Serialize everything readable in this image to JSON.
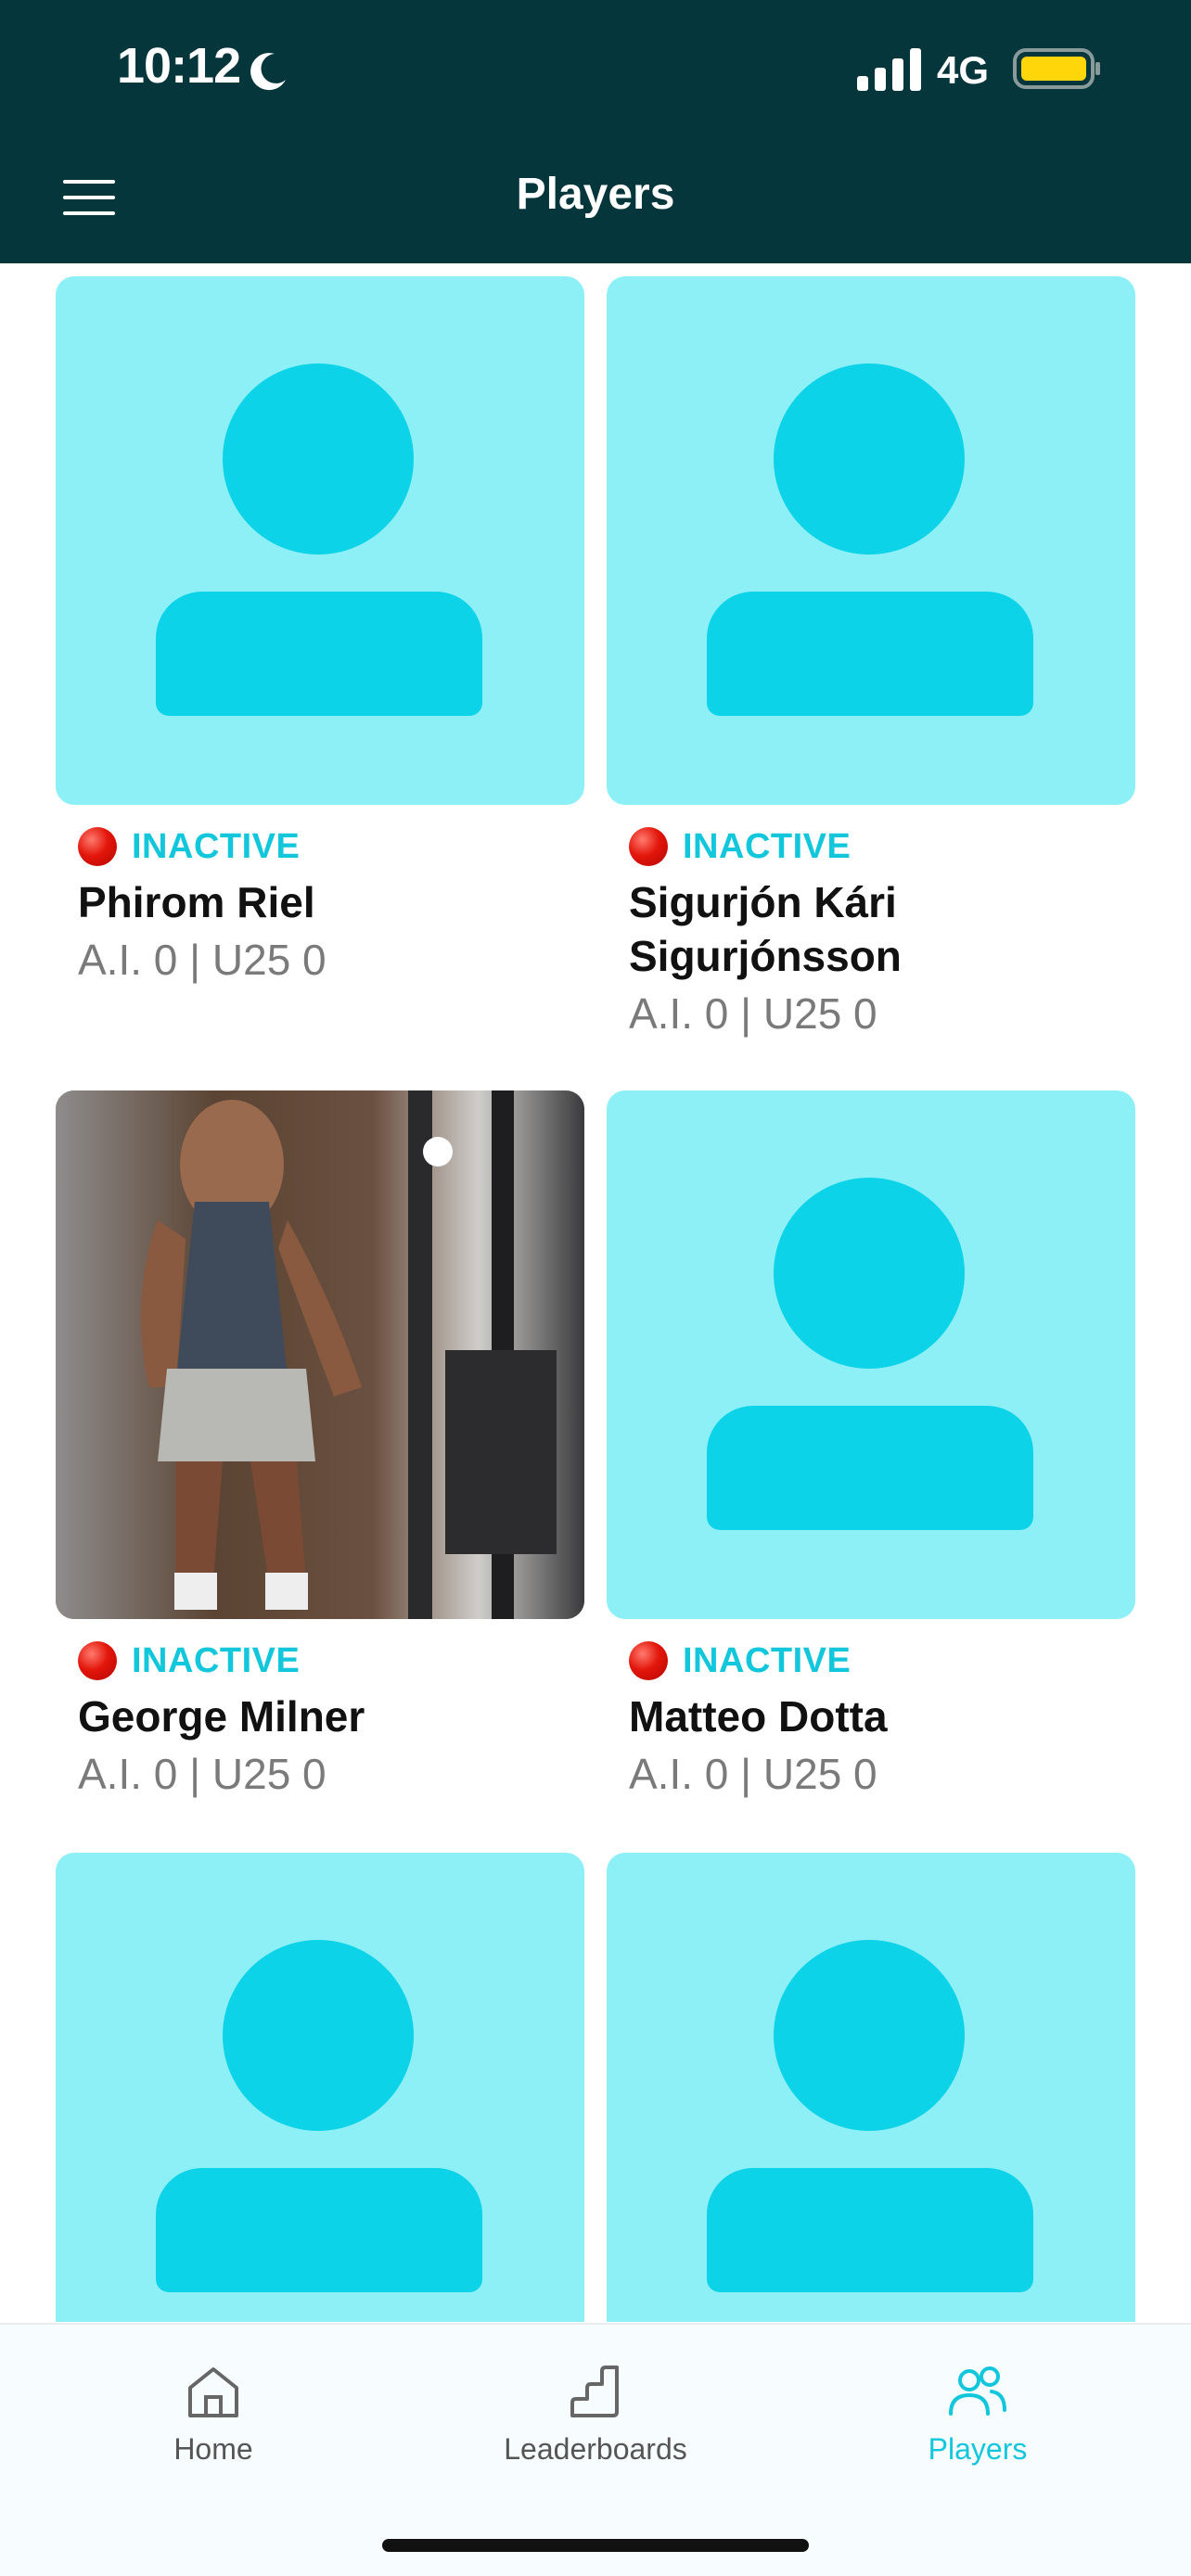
{
  "status_bar": {
    "time": "10:12",
    "network": "4G",
    "battery_color": "#ffd60a"
  },
  "header": {
    "title": "Players",
    "menu_icon": "hamburger-icon",
    "background": "#04363c"
  },
  "accent_color": "#12c6dc",
  "players": [
    {
      "status": "INACTIVE",
      "name": "Phirom Riel",
      "stats": "A.I. 0 | U25 0",
      "photo": "placeholder"
    },
    {
      "status": "INACTIVE",
      "name": "Sigurjón Kári Sigurjónsson",
      "stats": "A.I. 0 | U25 0",
      "photo": "placeholder"
    },
    {
      "status": "INACTIVE",
      "name": "George Milner",
      "stats": "A.I. 0 | U25 0",
      "photo": "gym-photo"
    },
    {
      "status": "INACTIVE",
      "name": "Matteo Dotta",
      "stats": "A.I. 0 | U25 0",
      "photo": "placeholder"
    },
    {
      "status": "",
      "name": "",
      "stats": "",
      "photo": "placeholder"
    },
    {
      "status": "",
      "name": "",
      "stats": "",
      "photo": "placeholder"
    }
  ],
  "nav": {
    "items": [
      {
        "label": "Home",
        "icon": "home-icon",
        "active": false
      },
      {
        "label": "Leaderboards",
        "icon": "leaderboard-stairs-icon",
        "active": false
      },
      {
        "label": "Players",
        "icon": "users-icon",
        "active": true
      }
    ]
  }
}
